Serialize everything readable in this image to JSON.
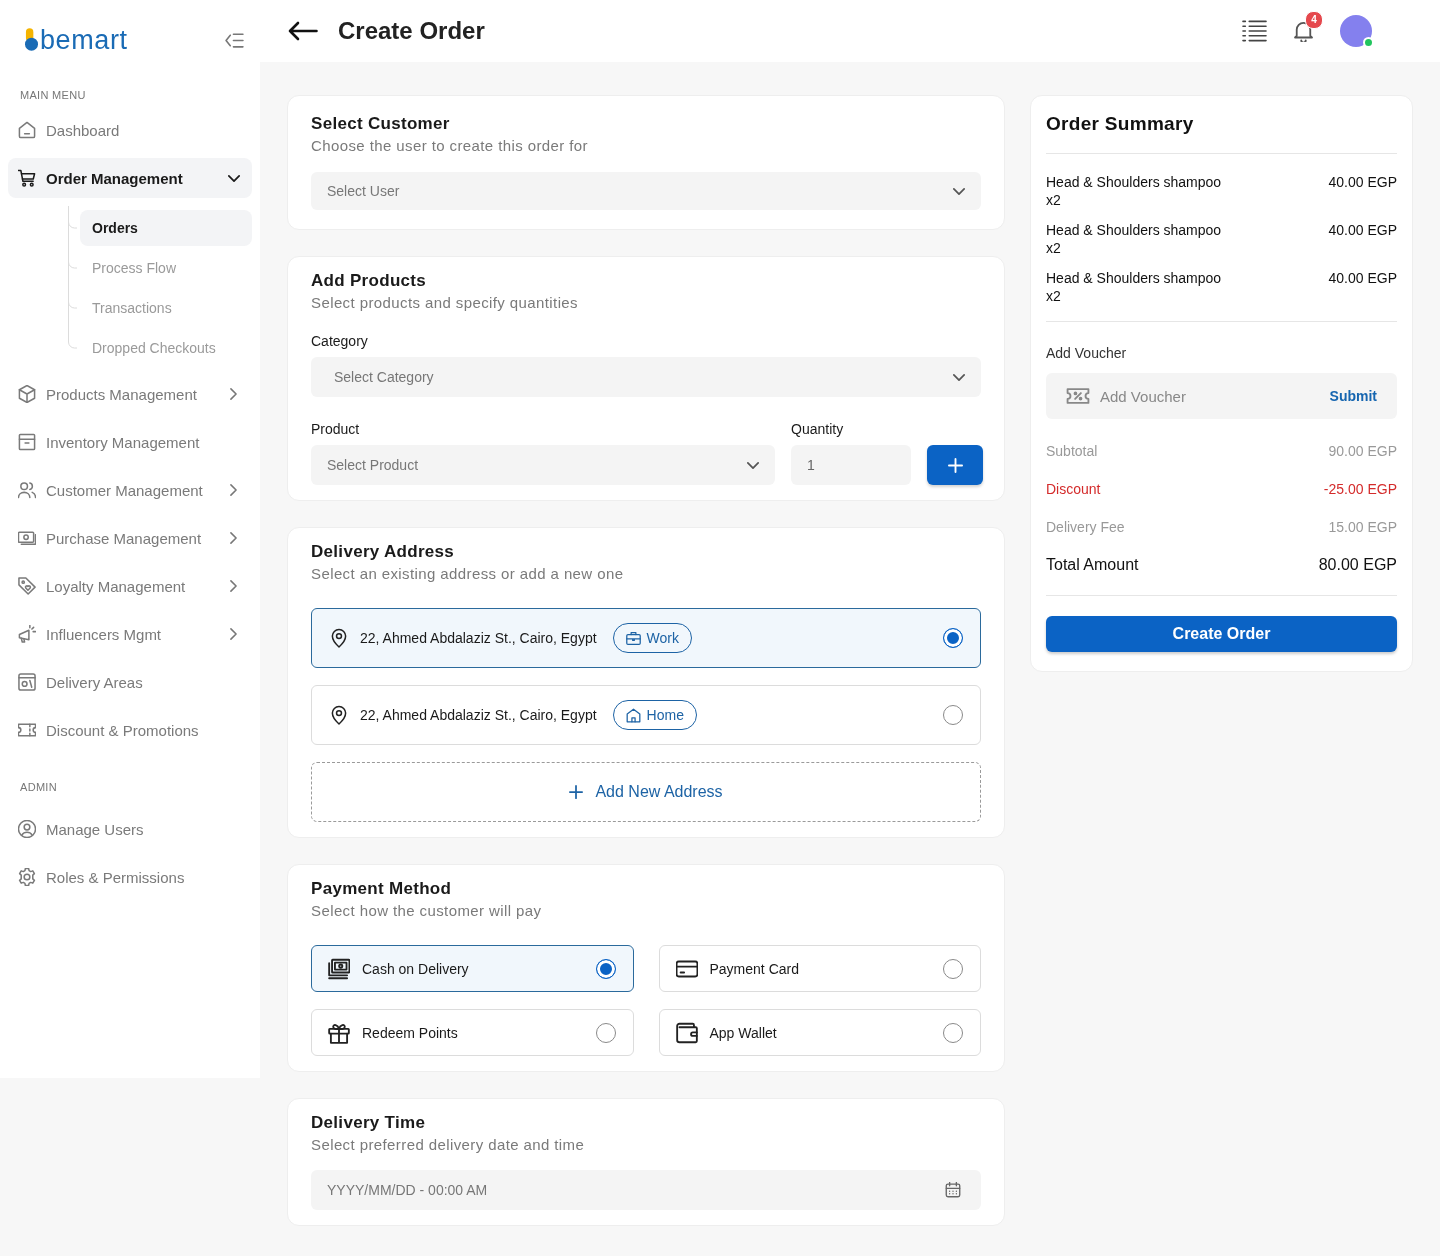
{
  "sidebar": {
    "logo": "bemart",
    "sections": [
      {
        "heading": "MAIN MENU",
        "items": [
          {
            "label": "Dashboard",
            "kind": "link",
            "selected": false
          },
          {
            "label": "Order Management",
            "kind": "group",
            "selected": true,
            "expanded": true,
            "children": [
              {
                "label": "Orders",
                "selected": true
              },
              {
                "label": "Process Flow",
                "selected": false
              },
              {
                "label": "Transactions",
                "selected": false
              },
              {
                "label": "Dropped Checkouts",
                "selected": false
              }
            ]
          },
          {
            "label": "Products Management",
            "kind": "group",
            "selected": false,
            "expanded": false
          },
          {
            "label": "Inventory Management",
            "kind": "link",
            "selected": false
          },
          {
            "label": "Customer Management",
            "kind": "group",
            "selected": false,
            "expanded": false
          },
          {
            "label": "Purchase Management",
            "kind": "group",
            "selected": false,
            "expanded": false
          },
          {
            "label": "Loyalty Management",
            "kind": "group",
            "selected": false,
            "expanded": false
          },
          {
            "label": "Influencers Mgmt",
            "kind": "group",
            "selected": false,
            "expanded": false
          },
          {
            "label": "Delivery Areas",
            "kind": "link",
            "selected": false
          },
          {
            "label": "Discount & Promotions",
            "kind": "link",
            "selected": false
          }
        ]
      },
      {
        "heading": "ADMIN",
        "items": [
          {
            "label": "Manage Users",
            "kind": "link",
            "selected": false
          },
          {
            "label": "Roles & Permissions",
            "kind": "link",
            "selected": false
          }
        ]
      }
    ]
  },
  "header": {
    "title": "Create Order",
    "notification_count": "4",
    "avatar": {
      "online": true
    }
  },
  "select_customer": {
    "title": "Select Customer",
    "subtitle": "Choose the user to create this order for",
    "user_select": {
      "placeholder": "Select User"
    }
  },
  "add_products": {
    "title": "Add Products",
    "subtitle": "Select products and specify quantities",
    "category": {
      "label": "Category",
      "placeholder": "Select Category"
    },
    "product": {
      "label": "Product",
      "placeholder": "Select Product"
    },
    "quantity": {
      "label": "Quantity",
      "value": "1"
    }
  },
  "delivery_address": {
    "title": "Delivery Address",
    "subtitle": "Select an existing address or add a new one",
    "addresses": [
      {
        "address": "22, Ahmed Abdalaziz St., Cairo, Egypt",
        "tag": "Work",
        "selected": true
      },
      {
        "address": "22, Ahmed Abdalaziz St., Cairo, Egypt",
        "tag": "Home",
        "selected": false
      }
    ],
    "add_button": "Add New Address"
  },
  "payment_method": {
    "title": "Payment Method",
    "subtitle": "Select how the customer will pay",
    "options": [
      {
        "label": "Cash on Delivery",
        "selected": true
      },
      {
        "label": "Payment Card",
        "selected": false
      },
      {
        "label": "Redeem Points",
        "selected": false
      },
      {
        "label": "App Wallet",
        "selected": false
      }
    ]
  },
  "delivery_time": {
    "title": "Delivery Time",
    "subtitle": "Select preferred delivery date and time",
    "date_field": {
      "placeholder": "YYYY/MM/DD - 00:00 AM"
    }
  },
  "order_summary": {
    "title": "Order Summary",
    "items": [
      {
        "name": "Head & Shoulders shampoo",
        "quantity": "x2",
        "price": "40.00 EGP"
      },
      {
        "name": "Head & Shoulders shampoo",
        "quantity": "x2",
        "price": "40.00 EGP"
      },
      {
        "name": "Head & Shoulders shampoo",
        "quantity": "x2",
        "price": "40.00 EGP"
      }
    ],
    "voucher": {
      "label": "Add Voucher",
      "placeholder": "Add Voucher",
      "submit": "Submit"
    },
    "totals": [
      {
        "label": "Subtotal",
        "value": "90.00 EGP",
        "kind": "muted"
      },
      {
        "label": "Discount",
        "value": "-25.00 EGP",
        "kind": "discount"
      },
      {
        "label": "Delivery Fee",
        "value": "15.00 EGP",
        "kind": "muted"
      },
      {
        "label": "Total Amount",
        "value": "80.00 EGP",
        "kind": "total"
      }
    ],
    "button": "Create Order"
  }
}
